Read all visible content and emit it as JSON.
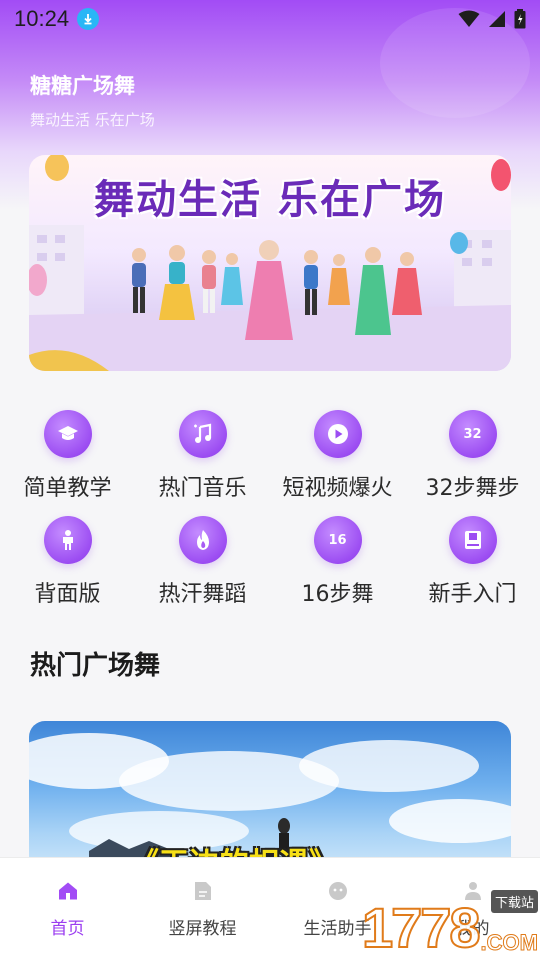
{
  "status_bar": {
    "time": "10:24"
  },
  "header": {
    "title": "糖糖广场舞",
    "subtitle": "舞动生活 乐在广场"
  },
  "banner": {
    "text": "舞动生活 乐在广场"
  },
  "categories": [
    {
      "label": "简单教学",
      "icon": "graduation-cap-icon"
    },
    {
      "label": "热门音乐",
      "icon": "music-note-icon"
    },
    {
      "label": "短视频爆火",
      "icon": "play-icon"
    },
    {
      "label": "32步舞步",
      "icon": "number-32-icon",
      "badge": "32"
    },
    {
      "label": "背面版",
      "icon": "person-icon"
    },
    {
      "label": "热汗舞蹈",
      "icon": "flame-icon"
    },
    {
      "label": "16步舞",
      "icon": "number-16-icon",
      "badge": "16"
    },
    {
      "label": "新手入门",
      "icon": "book-icon"
    }
  ],
  "section": {
    "title": "热门广场舞"
  },
  "video": {
    "title": "《天边的相遇》"
  },
  "bottom_nav": [
    {
      "label": "首页",
      "icon": "home-icon",
      "active": true
    },
    {
      "label": "竖屏教程",
      "icon": "document-icon",
      "active": false
    },
    {
      "label": "生活助手",
      "icon": "assistant-icon",
      "active": false
    },
    {
      "label": "我的",
      "icon": "profile-icon",
      "active": false
    }
  ],
  "watermark": {
    "number": "1778",
    "domain": ".COM",
    "tag": "下载站"
  },
  "colors": {
    "accent": "#9b3df0",
    "icon_bg": "#9c4df2"
  }
}
